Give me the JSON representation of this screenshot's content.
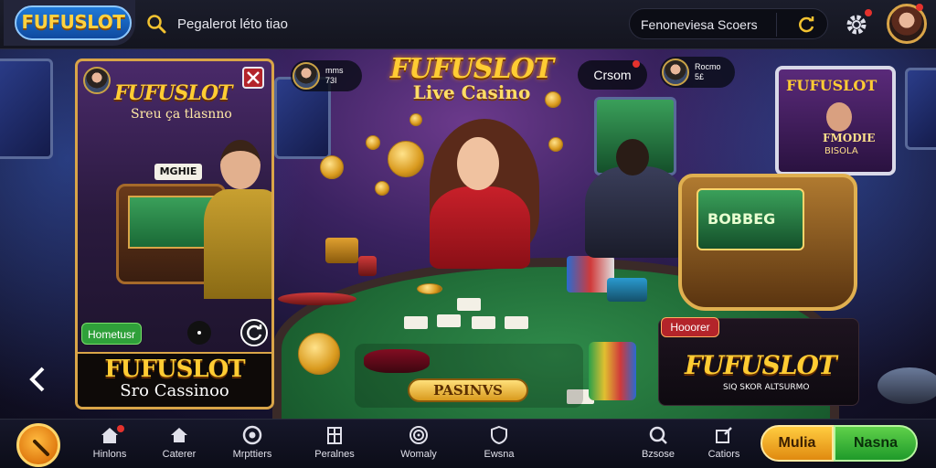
{
  "header": {
    "logo_text": "FUFUSLOT",
    "search_text": "Pegalerot léto tiao",
    "pill_search_text": "Fenoneviesa Scoers",
    "icons": [
      "search-icon",
      "refresh-icon",
      "gear-icon",
      "avatar"
    ]
  },
  "scene": {
    "center_logo": {
      "line1": "FUFUSLOT",
      "line2": "Live Casino"
    },
    "players": [
      {
        "line1": "mms",
        "line2": "73I"
      },
      {
        "line1": "Rocmo",
        "line2": "5£"
      }
    ],
    "casino_pill": "Crsom",
    "promo": {
      "title": "FUFUSLOT",
      "subtitle": "Sreu ça tlasnno",
      "machine_label": "MGHIE",
      "badge": "Hometusr",
      "footer_title": "FUFUSLOT",
      "footer_sub": "Sro Cassinoo"
    },
    "right_screen": {
      "title": "FUFUSLOT",
      "line1": "FMODIE",
      "line2": "BISOLA"
    },
    "slot_machine_screen": "BOBBEG",
    "cta_label": "PASINVS",
    "brand_right": {
      "tag": "Hooorer",
      "title": "FUFUSLOT",
      "sub": "SIQ SKOR ALTSURMO"
    }
  },
  "bottom_nav": {
    "items": [
      {
        "label": "Hinlons",
        "icon": "home-icon"
      },
      {
        "label": "Caterer",
        "icon": "house-icon"
      },
      {
        "label": "Mrpttiers",
        "icon": "casino-chip-icon"
      },
      {
        "label": "Peralnes",
        "icon": "building-icon"
      },
      {
        "label": "Womaly",
        "icon": "roulette-icon"
      },
      {
        "label": "Ewsna",
        "icon": "shield-icon"
      },
      {
        "label": "Bzsose",
        "icon": "search-icon"
      },
      {
        "label": "Catiors",
        "icon": "edit-icon"
      }
    ],
    "btn_left": "Mulia",
    "btn_right": "Nasna"
  },
  "colors": {
    "gold": "#ffcc33",
    "green_btn": "#5fd14a",
    "orange_btn": "#ffcc40",
    "bg": "#0d0f1c"
  }
}
